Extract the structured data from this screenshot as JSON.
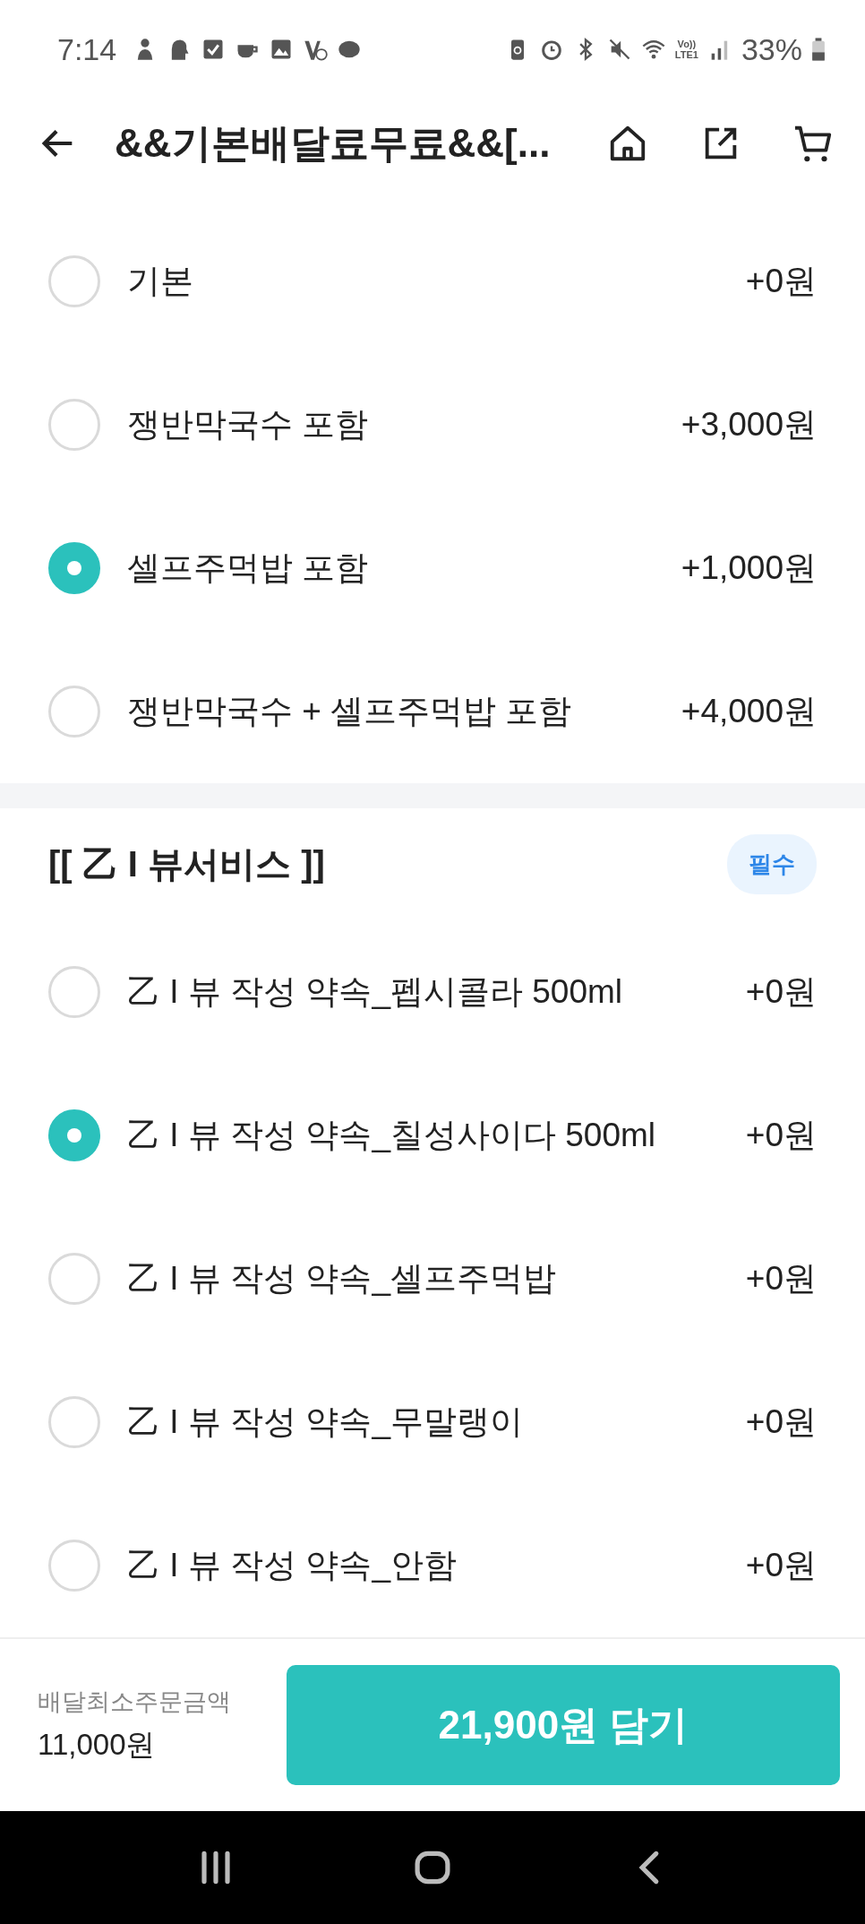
{
  "status_bar": {
    "time": "7:14",
    "network_top": "Vo))",
    "network_bottom": "LTE1",
    "battery": "33%"
  },
  "header": {
    "title": "&&기본배달료무료&&[..."
  },
  "option_groups": [
    {
      "options": [
        {
          "label": "기본",
          "price": "+0원",
          "selected": false
        },
        {
          "label": "쟁반막국수 포함",
          "price": "+3,000원",
          "selected": false
        },
        {
          "label": "셀프주먹밥 포함",
          "price": "+1,000원",
          "selected": true
        },
        {
          "label": "쟁반막국수 + 셀프주먹밥 포함",
          "price": "+4,000원",
          "selected": false
        }
      ]
    },
    {
      "title": "[[ 乙 I 뷰서비스 ]]",
      "badge": "필수",
      "options": [
        {
          "label": "乙 I 뷰 작성 약속_펩시콜라 500ml",
          "price": "+0원",
          "selected": false
        },
        {
          "label": "乙 I 뷰 작성 약속_칠성사이다 500ml",
          "price": "+0원",
          "selected": true
        },
        {
          "label": "乙 I 뷰 작성 약속_셀프주먹밥",
          "price": "+0원",
          "selected": false
        },
        {
          "label": "乙 I 뷰 작성 약속_무말랭이",
          "price": "+0원",
          "selected": false
        },
        {
          "label": "乙 I 뷰 작성 약속_안함",
          "price": "+0원",
          "selected": false
        }
      ]
    }
  ],
  "footer": {
    "min_order_label": "배달최소주문금액",
    "min_order_amount": "11,000원",
    "add_button": "21,900원 담기"
  }
}
